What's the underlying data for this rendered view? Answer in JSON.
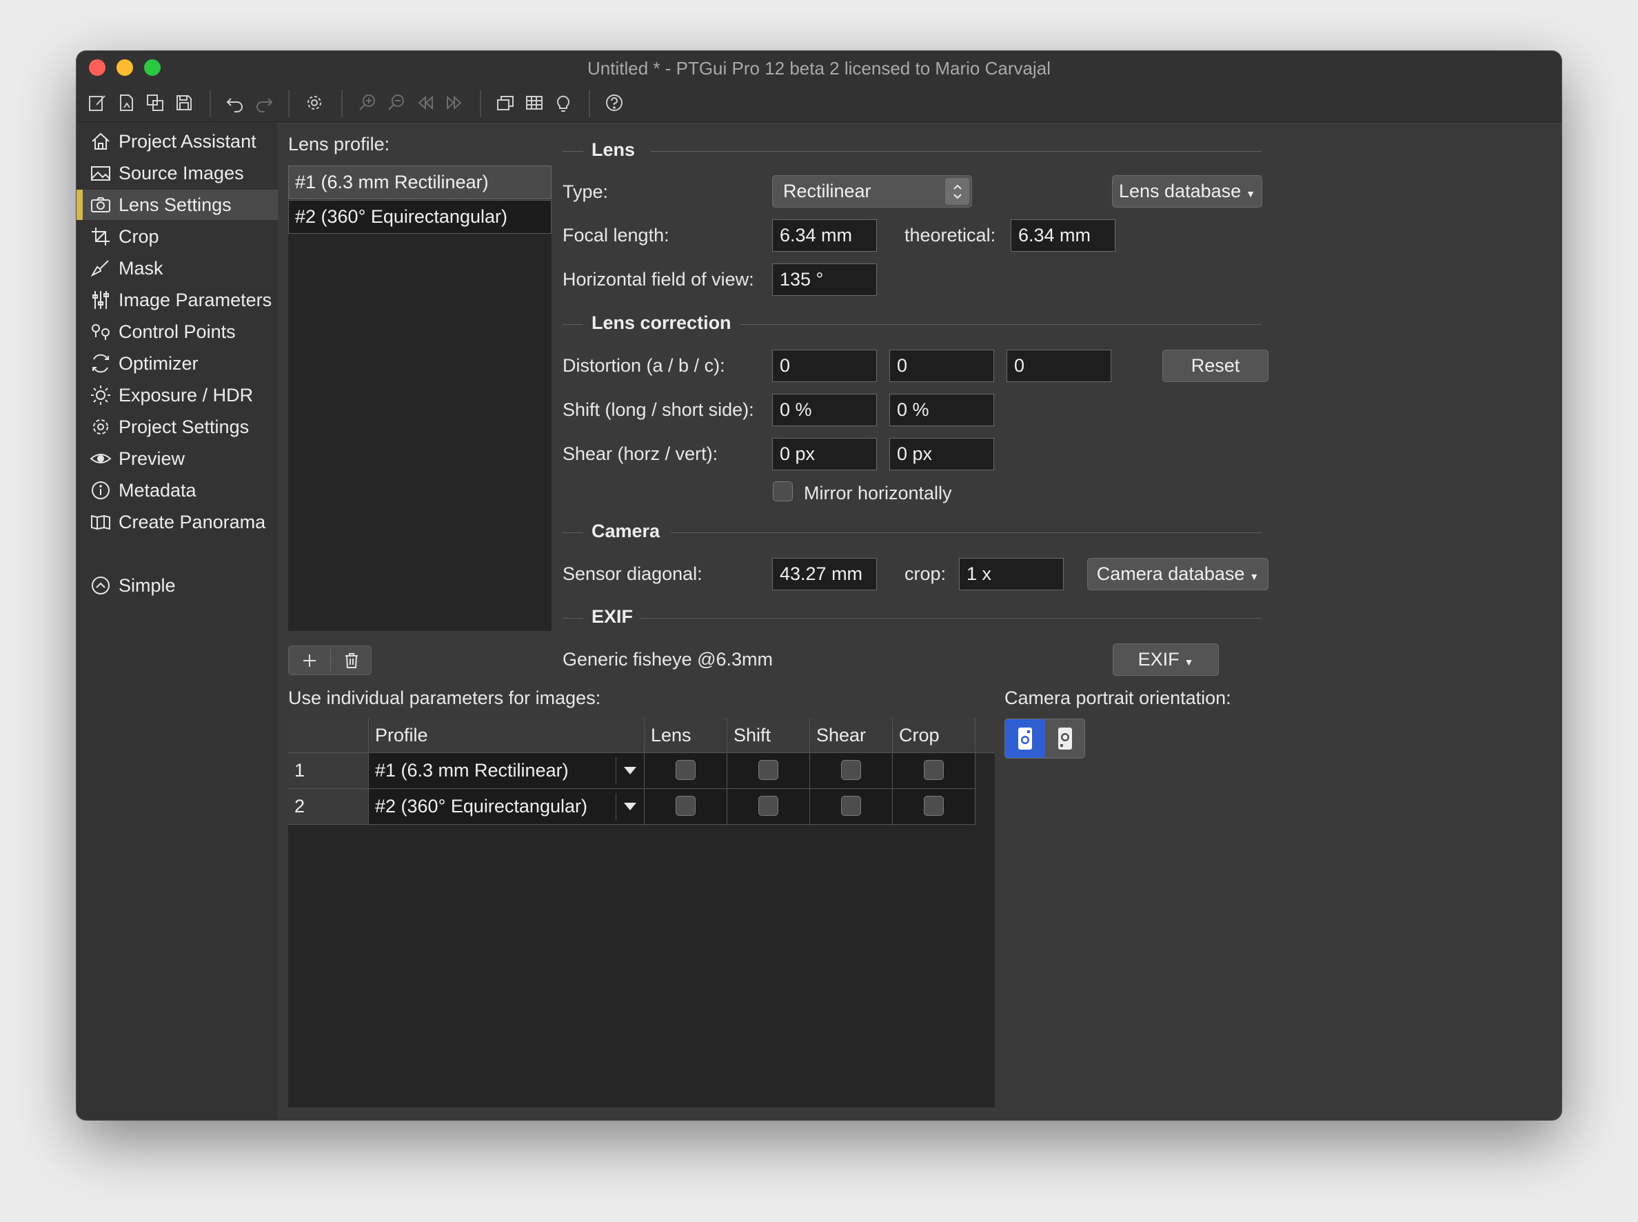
{
  "window": {
    "title": "Untitled * - PTGui Pro 12 beta 2 licensed to Mario Carvajal"
  },
  "toolbar": {
    "icons": [
      "new-project-icon",
      "open-project-icon",
      "save-as-icon",
      "save-icon",
      "undo-icon",
      "redo-icon",
      "settings-icon",
      "zoom-in-icon",
      "zoom-out-icon",
      "prev-icon",
      "next-icon",
      "panorama-editor-icon",
      "grid-icon",
      "lightbulb-icon",
      "help-icon"
    ]
  },
  "sidebar": {
    "items": [
      {
        "label": "Project Assistant",
        "icon": "home-icon"
      },
      {
        "label": "Source Images",
        "icon": "image-icon"
      },
      {
        "label": "Lens Settings",
        "icon": "camera-icon",
        "active": true
      },
      {
        "label": "Crop",
        "icon": "crop-icon"
      },
      {
        "label": "Mask",
        "icon": "brush-icon"
      },
      {
        "label": "Image Parameters",
        "icon": "sliders-icon"
      },
      {
        "label": "Control Points",
        "icon": "control-points-icon"
      },
      {
        "label": "Optimizer",
        "icon": "optimizer-icon"
      },
      {
        "label": "Exposure / HDR",
        "icon": "sun-icon"
      },
      {
        "label": "Project Settings",
        "icon": "gear-icon"
      },
      {
        "label": "Preview",
        "icon": "eye-icon"
      },
      {
        "label": "Metadata",
        "icon": "info-icon"
      },
      {
        "label": "Create Panorama",
        "icon": "panorama-icon"
      }
    ],
    "mode": {
      "label": "Simple",
      "icon": "chevron-up-circle-icon"
    }
  },
  "lens_profile": {
    "heading": "Lens profile:",
    "items": [
      "#1 (6.3 mm Rectilinear)",
      "#2 (360° Equirectangular)"
    ],
    "selected_index": 0
  },
  "lens": {
    "section": "Lens",
    "type_label": "Type:",
    "type_value": "Rectilinear",
    "lens_db_button": "Lens database",
    "focal_label": "Focal length:",
    "focal_value": "6.34 mm",
    "theoretical_label": "theoretical:",
    "theoretical_value": "6.34 mm",
    "hfov_label": "Horizontal field of view:",
    "hfov_value": "135 °"
  },
  "lens_correction": {
    "section": "Lens correction",
    "distortion_label": "Distortion (a / b / c):",
    "distortion_a": "0",
    "distortion_b": "0",
    "distortion_c": "0",
    "reset_button": "Reset",
    "shift_label": "Shift (long / short side):",
    "shift_long": "0 %",
    "shift_short": "0 %",
    "shear_label": "Shear (horz / vert):",
    "shear_horz": "0 px",
    "shear_vert": "0 px",
    "mirror_label": "Mirror horizontally",
    "mirror_checked": false
  },
  "camera": {
    "section": "Camera",
    "sensor_label": "Sensor diagonal:",
    "sensor_value": "43.27 mm",
    "crop_label": "crop:",
    "crop_value": "1 x",
    "camera_db_button": "Camera database"
  },
  "exif": {
    "section": "EXIF",
    "text": "Generic fisheye @6.3mm",
    "button": "EXIF"
  },
  "params": {
    "heading": "Use individual parameters for images:",
    "columns": [
      "",
      "Profile",
      "Lens",
      "Shift",
      "Shear",
      "Crop"
    ],
    "rows": [
      {
        "num": "1",
        "profile": "#1 (6.3 mm Rectilinear)",
        "lens": false,
        "shift": false,
        "shear": false,
        "crop": false
      },
      {
        "num": "2",
        "profile": "#2 (360° Equirectangular)",
        "lens": false,
        "shift": false,
        "shear": false,
        "crop": false
      }
    ]
  },
  "orientation": {
    "heading": "Camera portrait orientation:",
    "options": [
      "rotate-left-camera-icon",
      "rotate-right-camera-icon"
    ],
    "selected_index": 0
  },
  "colors": {
    "accent": "#d6b74b",
    "selected_blue": "#2f5fd3",
    "window_bg": "#3a3a3a",
    "sidebar_bg": "#333333"
  }
}
